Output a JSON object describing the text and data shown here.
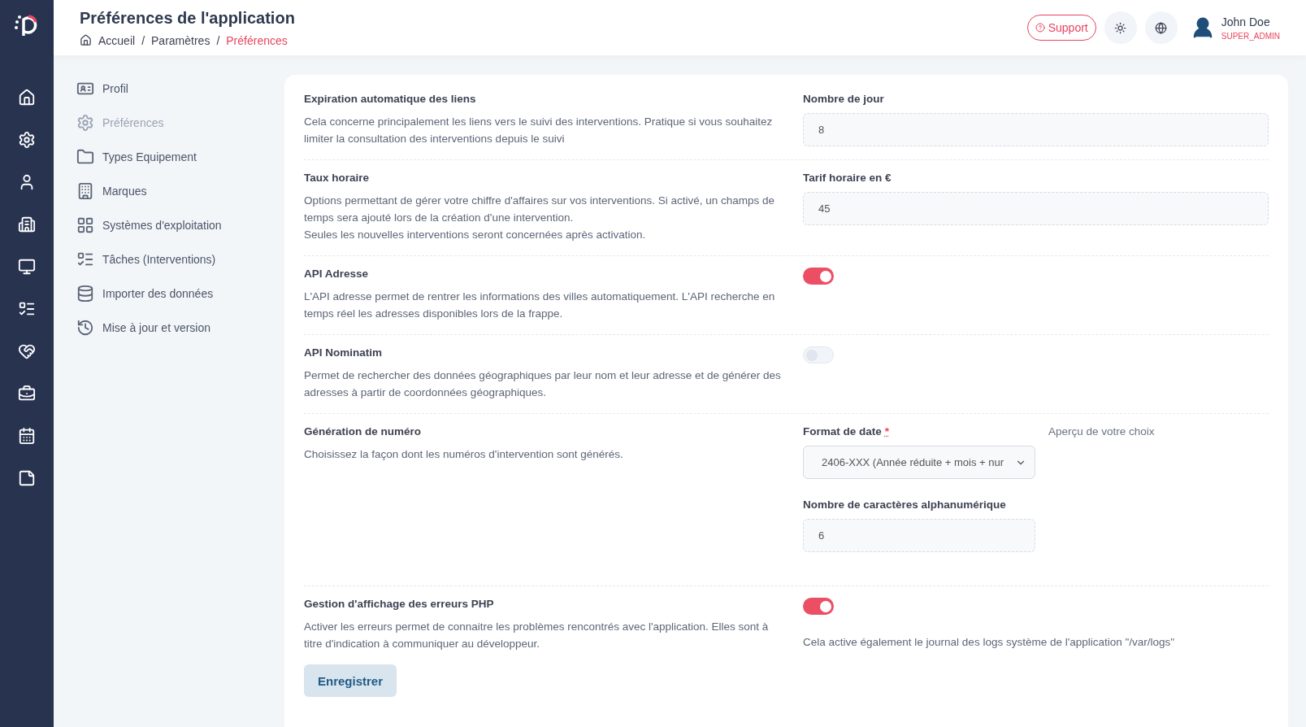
{
  "header": {
    "title": "Préférences de l'application",
    "breadcrumbs": [
      {
        "label": "Accueil",
        "current": false
      },
      {
        "label": "Paramètres",
        "current": false
      },
      {
        "label": "Préférences",
        "current": true
      }
    ],
    "separator": "/",
    "support": "Support",
    "user": {
      "name": "John Doe",
      "role": "SUPER_ADMIN"
    }
  },
  "menu": [
    {
      "label": "Profil",
      "selected": false
    },
    {
      "label": "Préférences",
      "selected": true
    },
    {
      "label": "Types Equipement",
      "selected": false
    },
    {
      "label": "Marques",
      "selected": false
    },
    {
      "label": "Systèmes d'exploitation",
      "selected": false
    },
    {
      "label": "Tâches (Interventions)",
      "selected": false
    },
    {
      "label": "Importer des données",
      "selected": false
    },
    {
      "label": "Mise à jour et version",
      "selected": false
    }
  ],
  "sections": [
    {
      "kind": "input",
      "title": "Expiration automatique des liens",
      "description": [
        "Cela concerne principalement les liens vers le suivi des interventions. Pratique si vous souhaitez limiter la consultation des interventions depuis le suivi"
      ],
      "field_label": "Nombre de jour",
      "value": "8"
    },
    {
      "kind": "input",
      "title": "Taux horaire",
      "description": [
        "Options permettant de gérer votre chiffre d'affaires sur vos interventions. Si activé, un champs de temps sera ajouté lors de la création d'une intervention.",
        "Seules les nouvelles interventions seront concernées après activation."
      ],
      "field_label": "Tarif horaire en €",
      "value": "45"
    },
    {
      "kind": "toggle",
      "title": "API Adresse",
      "description": [
        "L'API adresse permet de rentrer les informations des villes automatiquement. L'API recherche en temps réel les adresses disponibles lors de la frappe."
      ],
      "on": true
    },
    {
      "kind": "toggle",
      "title": "API Nominatim",
      "description": [
        "Permet de rechercher des données géographiques par leur nom et leur adresse et de générer des adresses à partir de coordonnées géographiques."
      ],
      "on": false
    },
    {
      "kind": "numbering",
      "title": "Génération de numéro",
      "description": [
        "Choisissez la façon dont les numéros d'intervention sont générés."
      ],
      "select_label": "Format de date",
      "required_mark": "*",
      "select_value": "2406-XXX (Année réduite + mois + nur",
      "preview_label": "Aperçu de votre choix",
      "count_label": "Nombre de caractères alphanumérique",
      "count_value": "6"
    },
    {
      "kind": "toggle",
      "title": "Gestion d'affichage des erreurs PHP",
      "description": [
        "Activer les erreurs permet de connaitre les problèmes rencontrés avec l'application. Elles sont à titre d'indication à communiquer au développeur."
      ],
      "on": true,
      "note": "Cela active également le journal des logs système de l'application \"/var/logs\""
    }
  ],
  "save_button": "Enregistrer"
}
